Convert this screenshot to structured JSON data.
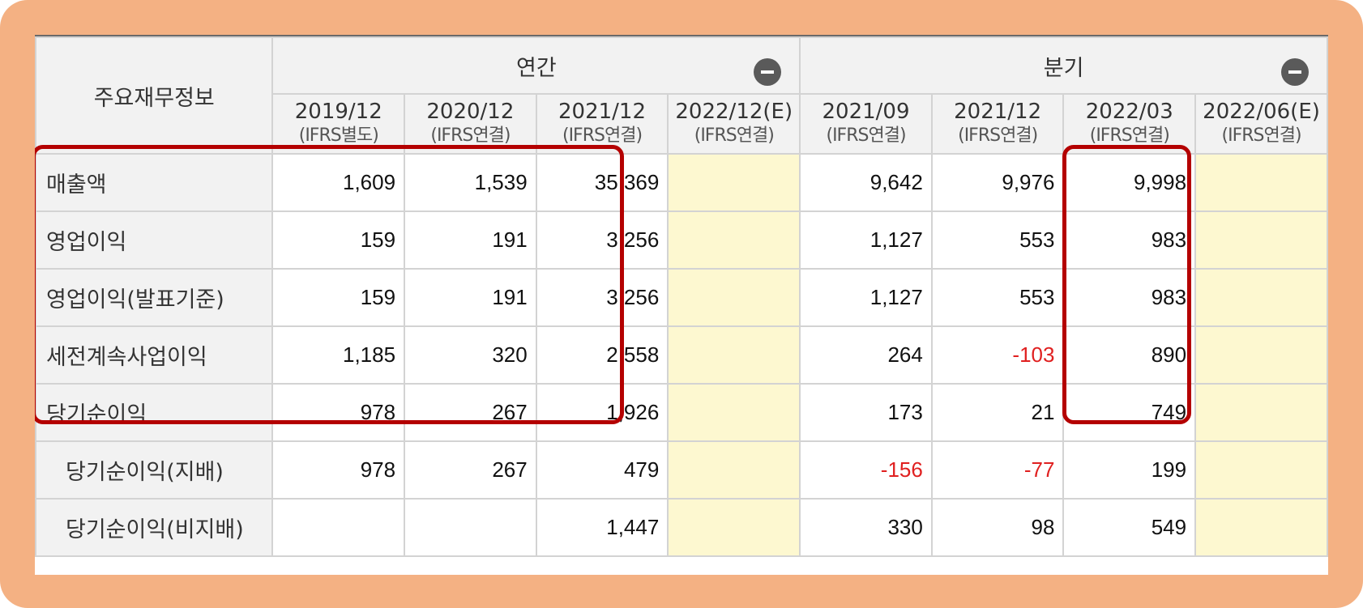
{
  "header": {
    "title": "주요재무정보",
    "groups": [
      {
        "label": "연간"
      },
      {
        "label": "분기"
      }
    ],
    "periods": [
      {
        "date": "2019/12",
        "basis": "(IFRS별도)"
      },
      {
        "date": "2020/12",
        "basis": "(IFRS연결)"
      },
      {
        "date": "2021/12",
        "basis": "(IFRS연결)"
      },
      {
        "date": "2022/12(E)",
        "basis": "(IFRS연결)"
      },
      {
        "date": "2021/09",
        "basis": "(IFRS연결)"
      },
      {
        "date": "2021/12",
        "basis": "(IFRS연결)"
      },
      {
        "date": "2022/03",
        "basis": "(IFRS연결)"
      },
      {
        "date": "2022/06(E)",
        "basis": "(IFRS연결)"
      }
    ]
  },
  "rows": [
    {
      "label": "매출액",
      "values": [
        "1,609",
        "1,539",
        "35,369",
        "",
        "9,642",
        "9,976",
        "9,998",
        ""
      ]
    },
    {
      "label": "영업이익",
      "values": [
        "159",
        "191",
        "3,256",
        "",
        "1,127",
        "553",
        "983",
        ""
      ]
    },
    {
      "label": "영업이익(발표기준)",
      "values": [
        "159",
        "191",
        "3,256",
        "",
        "1,127",
        "553",
        "983",
        ""
      ]
    },
    {
      "label": "세전계속사업이익",
      "values": [
        "1,185",
        "320",
        "2,558",
        "",
        "264",
        "-103",
        "890",
        ""
      ]
    },
    {
      "label": "당기순이익",
      "values": [
        "978",
        "267",
        "1,926",
        "",
        "173",
        "21",
        "749",
        ""
      ]
    },
    {
      "label": "당기순이익(지배)",
      "values": [
        "978",
        "267",
        "479",
        "",
        "-156",
        "-77",
        "199",
        ""
      ]
    },
    {
      "label": "당기순이익(비지배)",
      "values": [
        "",
        "",
        "1,447",
        "",
        "330",
        "98",
        "549",
        ""
      ]
    }
  ],
  "colors": {
    "frame": "#f4b183",
    "highlight": "#b40000",
    "negative": "#e02020",
    "estimate_bg": "#fdf8d0",
    "header_bg": "#f2f2f2"
  }
}
